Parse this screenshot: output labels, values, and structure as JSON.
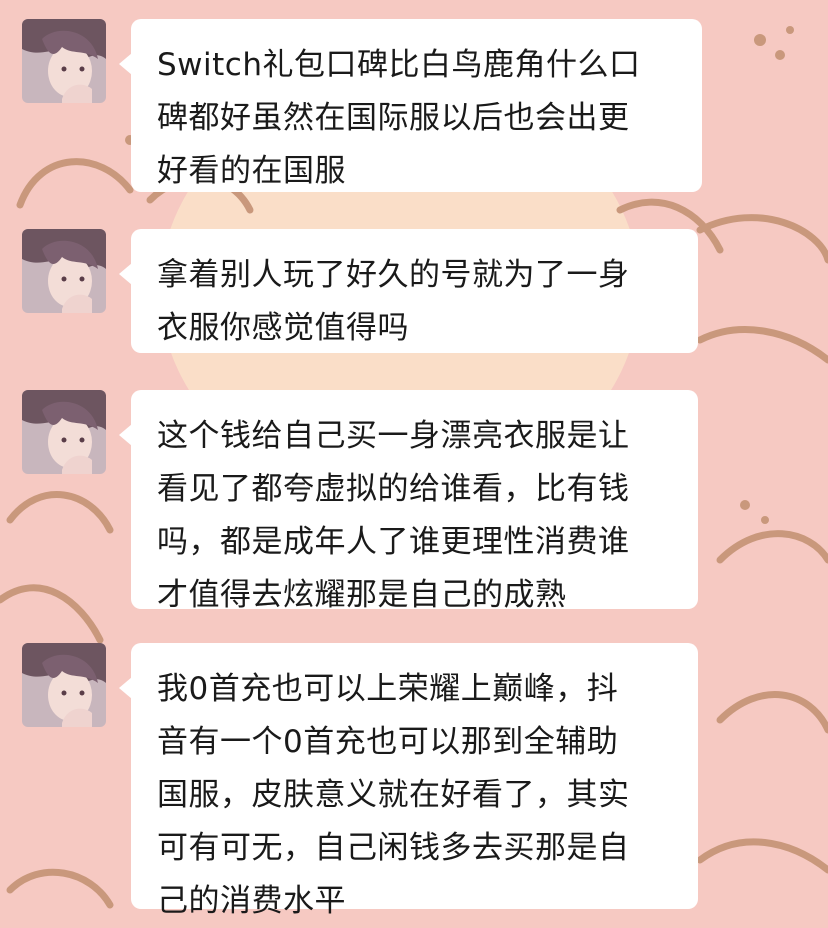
{
  "theme": {
    "background": "#f6c9c2",
    "bubble": "#ffffff",
    "text": "#1a1a1a",
    "decoration_stroke": "#c9987c"
  },
  "messages": [
    {
      "sender": "avatar",
      "avatar_icon": "anime-avatar-icon",
      "text": "Switch礼包口碑比白鸟鹿角什么口\n碑都好虽然在国际服以后也会出更\n好看的在国服"
    },
    {
      "sender": "avatar",
      "avatar_icon": "anime-avatar-icon",
      "text": "拿着别人玩了好久的号就为了一身\n衣服你感觉值得吗"
    },
    {
      "sender": "avatar",
      "avatar_icon": "anime-avatar-icon",
      "text": "这个钱给自己买一身漂亮衣服是让\n看见了都夸虚拟的给谁看，比有钱\n吗，都是成年人了谁更理性消费谁\n才值得去炫耀那是自己的成熟"
    },
    {
      "sender": "avatar",
      "avatar_icon": "anime-avatar-icon",
      "text": "我0首充也可以上荣耀上巅峰，抖\n音有一个0首充也可以那到全辅助\n国服，皮肤意义就在好看了，其实\n可有可无，自己闲钱多去买那是自\n己的消费水平"
    }
  ]
}
